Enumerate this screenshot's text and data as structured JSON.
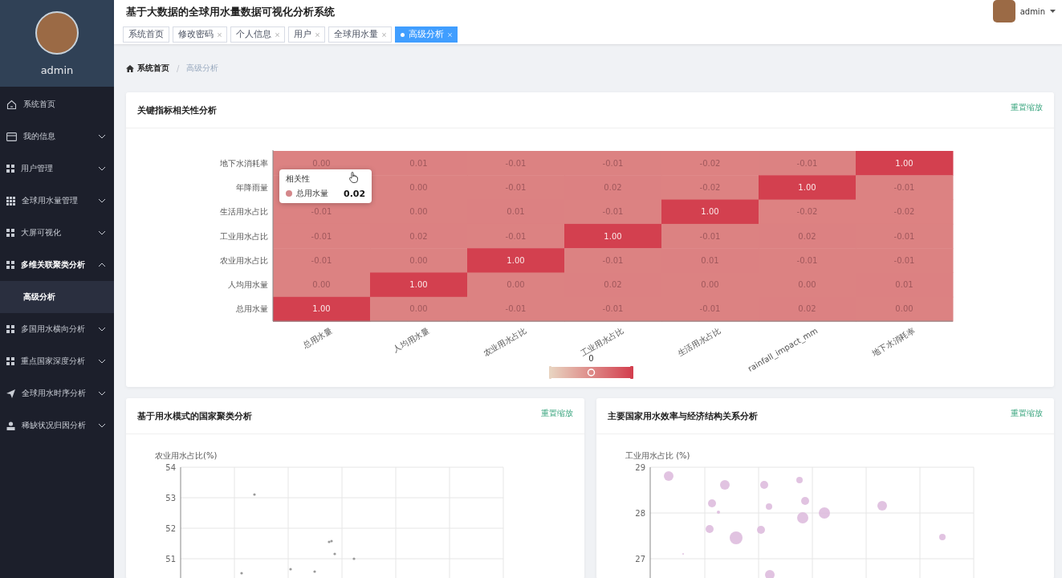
{
  "sidebar": {
    "user": "admin",
    "menu": [
      {
        "label": "系统首页",
        "kind": "link",
        "selected": false
      },
      {
        "label": "我的信息",
        "kind": "submenu",
        "expanded": false,
        "selected": false
      },
      {
        "label": "用户管理",
        "kind": "submenu",
        "expanded": false,
        "selected": false
      },
      {
        "label": "全球用水量管理",
        "kind": "submenu",
        "expanded": false,
        "selected": false
      },
      {
        "label": "大屏可视化",
        "kind": "submenu",
        "expanded": false,
        "selected": false
      },
      {
        "label": "多维关联聚类分析",
        "kind": "submenu",
        "expanded": true,
        "selected": false,
        "children": [
          {
            "label": "高级分析",
            "selected": true
          }
        ]
      },
      {
        "label": "多国用水横向分析",
        "kind": "submenu",
        "expanded": false,
        "selected": false
      },
      {
        "label": "重点国家深度分析",
        "kind": "submenu",
        "expanded": false,
        "selected": false
      },
      {
        "label": "全球用水时序分析",
        "kind": "submenu",
        "expanded": false,
        "selected": false
      },
      {
        "label": "稀缺状况归因分析",
        "kind": "submenu",
        "expanded": false,
        "selected": false
      }
    ]
  },
  "header": {
    "title": "基于大数据的全球用水量数据可视化分析系统",
    "user": "admin"
  },
  "tabs": [
    {
      "label": "系统首页",
      "closable": false,
      "selected": false
    },
    {
      "label": "修改密码",
      "closable": true,
      "selected": false
    },
    {
      "label": "个人信息",
      "closable": true,
      "selected": false
    },
    {
      "label": "用户",
      "closable": true,
      "selected": false
    },
    {
      "label": "全球用水量",
      "closable": true,
      "selected": false
    },
    {
      "label": "高级分析",
      "closable": true,
      "selected": true
    }
  ],
  "breadcrumb_separator": "/",
  "breadcrumb": [
    {
      "label": "系统首页",
      "current": false
    },
    {
      "label": "高级分析",
      "current": true
    }
  ],
  "correlation_card": {
    "title": "关键指标相关性分析",
    "action": "重置缩放",
    "heatmap": {
      "x_labels": [
        "总用水量",
        "人均用水量",
        "农业用水占比",
        "工业用水占比",
        "生活用水占比",
        "rainfall_impact_mm",
        "地下水消耗率"
      ],
      "rows": [
        {
          "label": "地下水消耗率",
          "cells": [
            "0.00",
            "0.01",
            "-0.01",
            "-0.01",
            "-0.02",
            "-0.01",
            "1.00"
          ]
        },
        {
          "label": "年降雨量",
          "cells": [
            null,
            "0.00",
            "-0.01",
            "0.02",
            "-0.02",
            "1.00",
            "-0.01"
          ]
        },
        {
          "label": "生活用水占比",
          "cells": [
            "-0.01",
            "0.00",
            "0.01",
            "-0.01",
            "1.00",
            "-0.02",
            "-0.02"
          ]
        },
        {
          "label": "工业用水占比",
          "cells": [
            "-0.01",
            "0.02",
            "-0.01",
            "1.00",
            "-0.01",
            "0.02",
            "-0.01"
          ]
        },
        {
          "label": "农业用水占比",
          "cells": [
            "-0.01",
            "0.00",
            "1.00",
            "-0.01",
            "0.01",
            "-0.01",
            "-0.01"
          ]
        },
        {
          "label": "人均用水量",
          "cells": [
            "0.00",
            "1.00",
            "0.00",
            "0.02",
            "0.00",
            "0.00",
            "0.01"
          ]
        },
        {
          "label": "总用水量",
          "cells": [
            "1.00",
            "0.00",
            "-0.01",
            "-0.01",
            "-0.01",
            "0.02",
            "0.00"
          ]
        }
      ]
    },
    "visual_map": {
      "label": "0",
      "level": 0.5
    },
    "tooltip": {
      "title": "相关性",
      "series": "总用水量",
      "value": "0.02"
    }
  },
  "scatter_cards": [
    {
      "title": "基于用水模式的国家聚类分析",
      "action": "重置缩放",
      "kind": "dots",
      "ylabel": "农业用水占比(%)",
      "yticks": [
        "54",
        "53",
        "52",
        "51"
      ]
    },
    {
      "title": "主要国家用水效率与经济结构关系分析",
      "action": "重置缩放",
      "kind": "bubbles",
      "ylabel": "工业用水占比 (%)",
      "yticks": [
        "29",
        "28",
        "27"
      ]
    }
  ]
}
